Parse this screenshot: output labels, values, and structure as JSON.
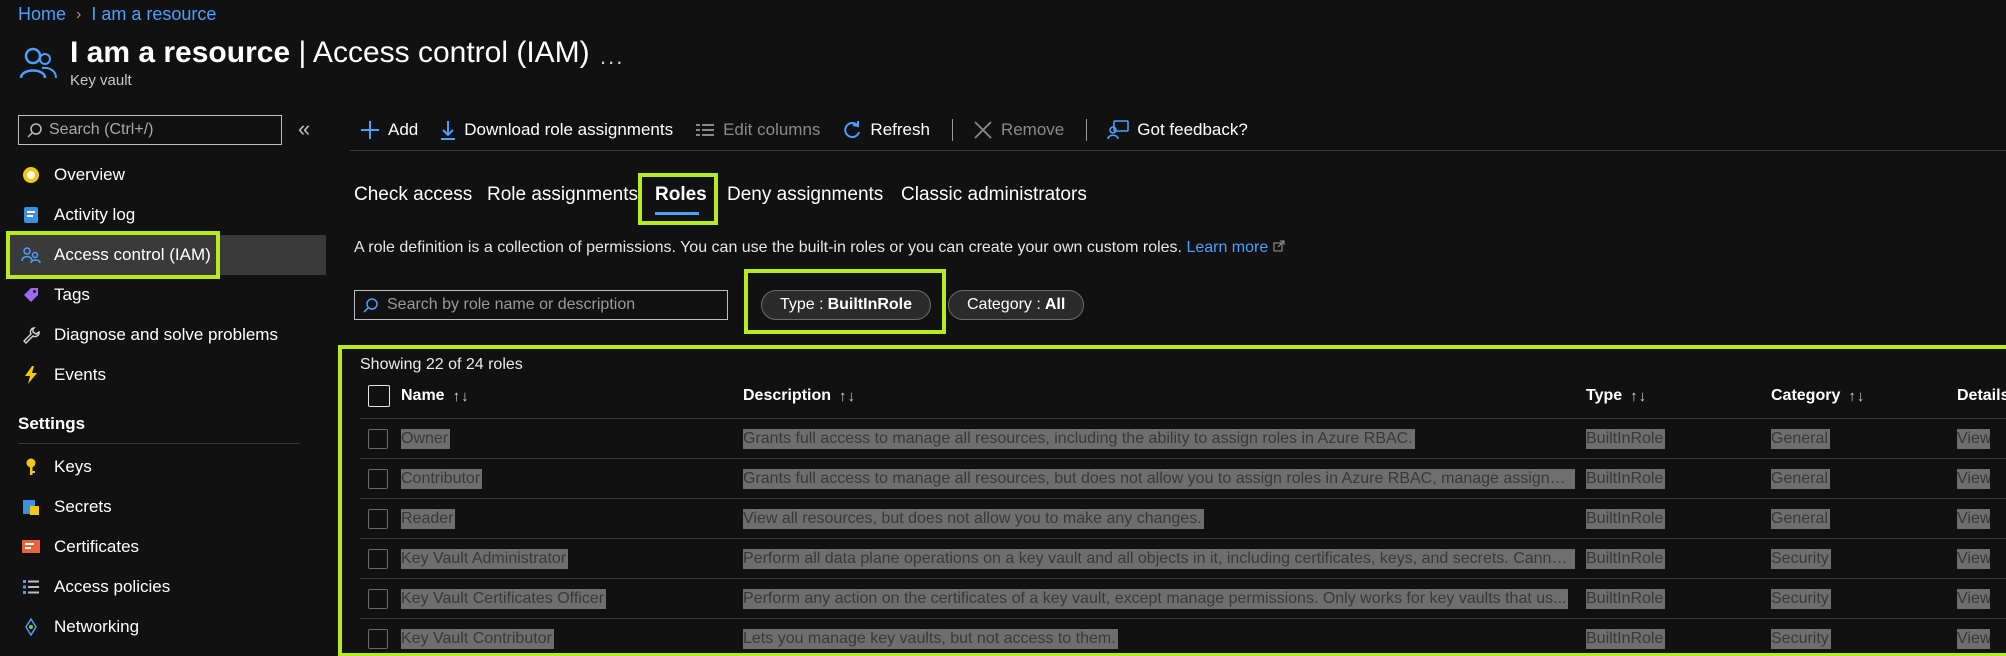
{
  "breadcrumb": {
    "home": "Home",
    "current": "I am a resource"
  },
  "header": {
    "title_bold": "I am a resource",
    "title_rest": " | Access control (IAM)",
    "subtitle": "Key vault",
    "more": "..."
  },
  "sidebar": {
    "search_placeholder": "Search (Ctrl+/)",
    "collapse": "«",
    "items": [
      {
        "label": "Overview",
        "icon": "overview-icon"
      },
      {
        "label": "Activity log",
        "icon": "activity-log-icon"
      },
      {
        "label": "Access control (IAM)",
        "icon": "iam-icon",
        "active": true
      },
      {
        "label": "Tags",
        "icon": "tag-icon"
      },
      {
        "label": "Diagnose and solve problems",
        "icon": "wrench-icon"
      },
      {
        "label": "Events",
        "icon": "lightning-icon"
      }
    ],
    "section": "Settings",
    "settings_items": [
      {
        "label": "Keys",
        "icon": "key-icon"
      },
      {
        "label": "Secrets",
        "icon": "secrets-icon"
      },
      {
        "label": "Certificates",
        "icon": "certificate-icon"
      },
      {
        "label": "Access policies",
        "icon": "policies-icon"
      },
      {
        "label": "Networking",
        "icon": "networking-icon"
      }
    ]
  },
  "toolbar": {
    "add": "Add",
    "download": "Download role assignments",
    "edit_columns": "Edit columns",
    "refresh": "Refresh",
    "remove": "Remove",
    "feedback": "Got feedback?"
  },
  "tabs": [
    "Check access",
    "Role assignments",
    "Roles",
    "Deny assignments",
    "Classic administrators"
  ],
  "description": {
    "text": "A role definition is a collection of permissions. You can use the built-in roles or you can create your own custom roles. ",
    "link": "Learn more"
  },
  "filters": {
    "search_placeholder": "Search by role name or description",
    "type_label": "Type : ",
    "type_value": "BuiltInRole",
    "category_label": "Category : ",
    "category_value": "All"
  },
  "table": {
    "showing": "Showing 22 of 24 roles",
    "headers": {
      "name": "Name",
      "description": "Description",
      "type": "Type",
      "category": "Category",
      "details": "Details"
    },
    "sort_glyph": "↑↓",
    "rows": [
      {
        "name": "Owner",
        "description": "Grants full access to manage all resources, including the ability to assign roles in Azure RBAC.",
        "type": "BuiltInRole",
        "category": "General",
        "details": "View"
      },
      {
        "name": "Contributor",
        "description": "Grants full access to manage all resources, but does not allow you to assign roles in Azure RBAC, manage assignm...",
        "type": "BuiltInRole",
        "category": "General",
        "details": "View"
      },
      {
        "name": "Reader",
        "description": "View all resources, but does not allow you to make any changes.",
        "type": "BuiltInRole",
        "category": "General",
        "details": "View"
      },
      {
        "name": "Key Vault Administrator",
        "description": "Perform all data plane operations on a key vault and all objects in it, including certificates, keys, and secrets. Canno...",
        "type": "BuiltInRole",
        "category": "Security",
        "details": "View"
      },
      {
        "name": "Key Vault Certificates Officer",
        "description": "Perform any action on the certificates of a key vault, except manage permissions. Only works for key vaults that us...",
        "type": "BuiltInRole",
        "category": "Security",
        "details": "View"
      },
      {
        "name": "Key Vault Contributor",
        "description": "Lets you manage key vaults, but not access to them.",
        "type": "BuiltInRole",
        "category": "Security",
        "details": "View"
      }
    ]
  },
  "colors": {
    "accent": "#4aa0ff",
    "highlight": "#b7ea1f",
    "background": "#111111"
  }
}
